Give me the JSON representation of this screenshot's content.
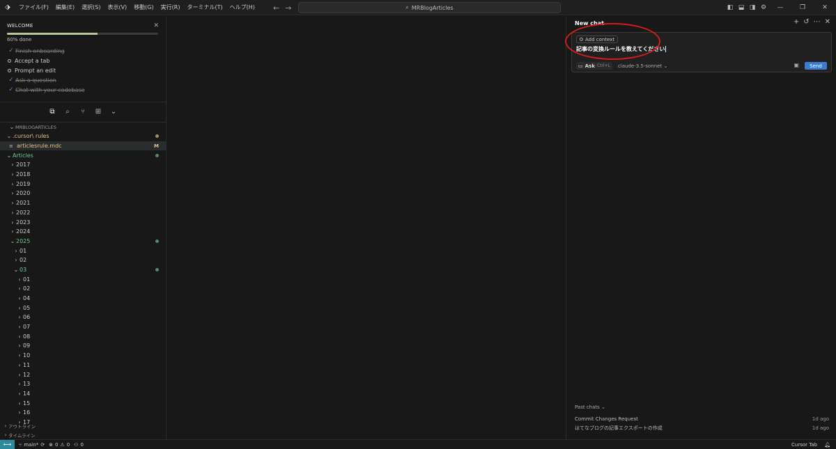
{
  "titlebar": {
    "menu": [
      "ファイル(F)",
      "編集(E)",
      "選択(S)",
      "表示(V)",
      "移動(G)",
      "実行(R)",
      "ターミナル(T)",
      "ヘルプ(H)"
    ],
    "search_text": "MRBlogArticles"
  },
  "welcome": {
    "title": "WELCOME",
    "progress_percent": 60,
    "progress_text": "60% done",
    "tasks": [
      {
        "label": "Finish onboarding",
        "done": true
      },
      {
        "label": "Accept a tab",
        "done": false
      },
      {
        "label": "Prompt an edit",
        "done": false
      },
      {
        "label": "Ask a question",
        "done": true
      },
      {
        "label": "Chat with your codebase",
        "done": true
      }
    ]
  },
  "explorer": {
    "header": "MRBLOGARTICLES",
    "tree": [
      {
        "label": ".cursor\\ rules",
        "depth": 0,
        "kind": "folder-open",
        "color": "yellow",
        "badge": "dot-yellow"
      },
      {
        "label": "articlesrule.mdc",
        "depth": 1,
        "kind": "file",
        "color": "yellow",
        "badge": "M",
        "selected": true
      },
      {
        "label": "Articles",
        "depth": 0,
        "kind": "folder-open",
        "color": "green",
        "badge": "dot-green"
      },
      {
        "label": "2017",
        "depth": 1,
        "kind": "folder"
      },
      {
        "label": "2018",
        "depth": 1,
        "kind": "folder"
      },
      {
        "label": "2019",
        "depth": 1,
        "kind": "folder"
      },
      {
        "label": "2020",
        "depth": 1,
        "kind": "folder"
      },
      {
        "label": "2021",
        "depth": 1,
        "kind": "folder"
      },
      {
        "label": "2022",
        "depth": 1,
        "kind": "folder"
      },
      {
        "label": "2023",
        "depth": 1,
        "kind": "folder"
      },
      {
        "label": "2024",
        "depth": 1,
        "kind": "folder"
      },
      {
        "label": "2025",
        "depth": 1,
        "kind": "folder-open",
        "color": "green",
        "badge": "dot-green"
      },
      {
        "label": "01",
        "depth": 2,
        "kind": "folder"
      },
      {
        "label": "02",
        "depth": 2,
        "kind": "folder"
      },
      {
        "label": "03",
        "depth": 2,
        "kind": "folder-open",
        "color": "green",
        "badge": "dot-green"
      },
      {
        "label": "01",
        "depth": 3,
        "kind": "folder"
      },
      {
        "label": "02",
        "depth": 3,
        "kind": "folder"
      },
      {
        "label": "04",
        "depth": 3,
        "kind": "folder"
      },
      {
        "label": "05",
        "depth": 3,
        "kind": "folder"
      },
      {
        "label": "06",
        "depth": 3,
        "kind": "folder"
      },
      {
        "label": "07",
        "depth": 3,
        "kind": "folder"
      },
      {
        "label": "08",
        "depth": 3,
        "kind": "folder"
      },
      {
        "label": "09",
        "depth": 3,
        "kind": "folder"
      },
      {
        "label": "10",
        "depth": 3,
        "kind": "folder"
      },
      {
        "label": "11",
        "depth": 3,
        "kind": "folder"
      },
      {
        "label": "12",
        "depth": 3,
        "kind": "folder"
      },
      {
        "label": "13",
        "depth": 3,
        "kind": "folder"
      },
      {
        "label": "14",
        "depth": 3,
        "kind": "folder"
      },
      {
        "label": "15",
        "depth": 3,
        "kind": "folder"
      },
      {
        "label": "16",
        "depth": 3,
        "kind": "folder"
      },
      {
        "label": "17",
        "depth": 3,
        "kind": "folder"
      }
    ],
    "bottom_panels": [
      "アウトライン",
      "タイムライン"
    ]
  },
  "chat": {
    "tab_label": "New chat",
    "context_label": "Add context",
    "input_text": "記事の変換ルールを教えてください",
    "mode_label": "Ask",
    "mode_shortcut": "Ctrl+L",
    "model_label": "claude-3.5-sonnet",
    "send_label": "Send",
    "past_chats_title": "Past chats",
    "past_chats": [
      {
        "title": "Commit Changes Request",
        "time": "1d ago"
      },
      {
        "title": "はてなブログの記事エクスポートの作成",
        "time": "1d ago"
      }
    ]
  },
  "statusbar": {
    "branch": "main*",
    "errors": "0",
    "warnings": "0",
    "ports": "0",
    "right_label": "Cursor Tab"
  },
  "colors": {
    "accent": "#3b7cd2",
    "modified": "#e2c08d",
    "added": "#73c991",
    "highlight_ring": "#d51d1d"
  }
}
